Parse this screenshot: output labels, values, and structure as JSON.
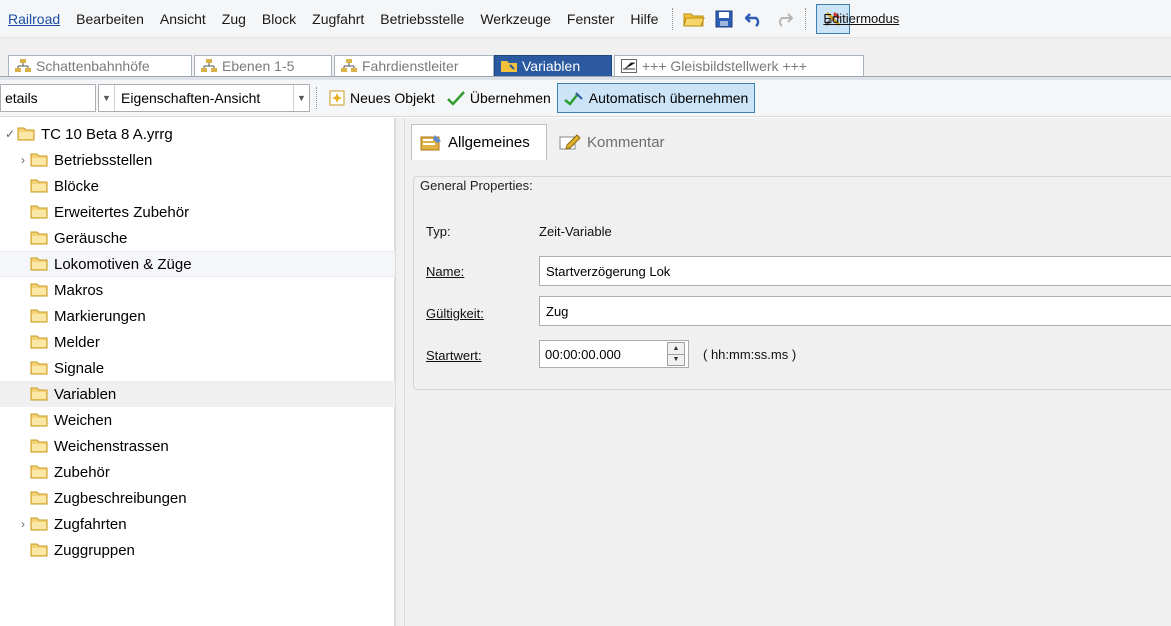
{
  "menu": {
    "items": [
      "Railroad",
      "Bearbeiten",
      "Ansicht",
      "Zug",
      "Block",
      "Zugfahrt",
      "Betriebsstelle",
      "Werkzeuge",
      "Fenster",
      "Hilfe"
    ],
    "edit_mode_label": "Editiermodus"
  },
  "tabs": [
    {
      "label": "Schattenbahnhöfe",
      "icon": "org-chart-icon"
    },
    {
      "label": "Ebenen 1-5",
      "icon": "org-chart-icon"
    },
    {
      "label": "Fahrdienstleiter",
      "icon": "org-chart-icon"
    },
    {
      "label": "Variablen",
      "icon": "folder-variable-icon"
    },
    {
      "label": "+++ Gleisbildstellwerk +++",
      "icon": "track-diagram-icon"
    }
  ],
  "toolbar": {
    "view_combo": "etails",
    "property_combo": "Eigenschaften-Ansicht",
    "new_object": "Neues Objekt",
    "apply": "Übernehmen",
    "auto_apply": "Automatisch übernehmen"
  },
  "tree": {
    "root": "TC 10 Beta 8 A.yrrg",
    "items": [
      {
        "label": "Betriebsstellen",
        "expandable": true
      },
      {
        "label": "Blöcke",
        "expandable": false
      },
      {
        "label": "Erweitertes Zubehör",
        "expandable": false
      },
      {
        "label": "Geräusche",
        "expandable": false
      },
      {
        "label": "Lokomotiven & Züge",
        "expandable": false
      },
      {
        "label": "Makros",
        "expandable": false
      },
      {
        "label": "Markierungen",
        "expandable": false
      },
      {
        "label": "Melder",
        "expandable": false
      },
      {
        "label": "Signale",
        "expandable": false
      },
      {
        "label": "Variablen",
        "expandable": false
      },
      {
        "label": "Weichen",
        "expandable": false
      },
      {
        "label": "Weichenstrassen",
        "expandable": false
      },
      {
        "label": "Zubehör",
        "expandable": false
      },
      {
        "label": "Zugbeschreibungen",
        "expandable": false
      },
      {
        "label": "Zugfahrten",
        "expandable": true
      },
      {
        "label": "Zuggruppen",
        "expandable": false
      }
    ]
  },
  "panel": {
    "tab_general": "Allgemeines",
    "tab_comment": "Kommentar",
    "group_title": "General Properties:",
    "type_label": "Typ:",
    "type_value": "Zeit-Variable",
    "name_label": "Name:",
    "name_value": "Startverzögerung Lok",
    "validity_label": "Gültigkeit:",
    "validity_value": "Zug",
    "start_label": "Startwert:",
    "start_value": "00:00:00.000",
    "start_format": "( hh:mm:ss.ms )"
  },
  "colors": {
    "active_tab": "#2b5aa0",
    "highlight_button": "#cce4f7",
    "folder": "#e8c35c"
  }
}
